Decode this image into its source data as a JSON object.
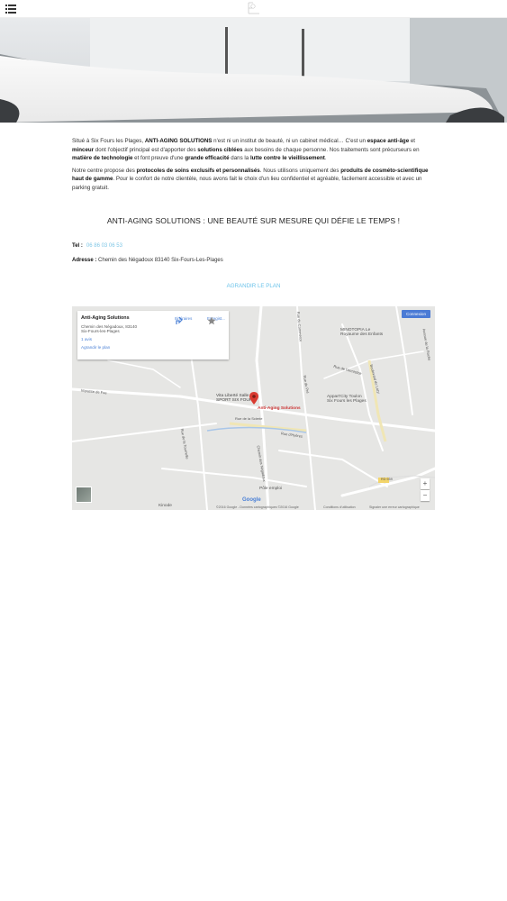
{
  "header": {
    "menu_icon": "hamburger-icon",
    "logo_icon": "brand-logo"
  },
  "intro": {
    "p1_a": "Situé à Six Fours les Plages, ",
    "p1_brand": "ANTI-AGING SOLUTIONS",
    "p1_b": " n'est ni un institut de beauté, ni un cabinet médical… C'est un ",
    "p1_c": "espace anti-âge",
    "p1_d": " et ",
    "p1_e": "minceur",
    "p1_f": " dont l'objectif principal est d'apporter des ",
    "p1_g": "solutions ciblées",
    "p1_h": " aux besoins de chaque personne. Nos traitements sont précurseurs en ",
    "p1_i": "matière de technologie",
    "p1_j": " et font preuve d'une ",
    "p1_k": "grande efficacité",
    "p1_l": " dans la ",
    "p1_m": "lutte contre le vieillissement",
    "p1_n": ".",
    "p2_a": "Notre centre propose des ",
    "p2_b": "protocoles de soins exclusifs et personnalisés",
    "p2_c": ". Nous utilisons uniquement des ",
    "p2_d": "produits de cosméto-scientifique haut de gamme",
    "p2_e": ".  Pour le confort de notre clientèle, nous avons fait le choix d'un lieu confidentiel et agréable, facilement accessible et avec un parking gratuit."
  },
  "headline": "ANTI-AGING SOLUTIONS : UNE BEAUTÉ SUR MESURE QUI DÉFIE LE TEMPS !",
  "contact": {
    "tel_label": "Tel :",
    "tel_value": "06 86 03 06 53",
    "address_label": "Adresse :",
    "address_value": "Chemin des Négadoux 83140 Six-Fours-Les-Plages"
  },
  "plan_link": "AGRANDIR LE PLAN",
  "map": {
    "card_title": "Anti-Aging Solutions",
    "card_address_1": "Chemin des Négadoux, 83140",
    "card_address_2": "Six-Fours-les-Plages",
    "card_reviews": "1 avis",
    "card_enlarge": "Agrandir le plan",
    "action_directions": "Itinéraires",
    "action_save": "Enregist...",
    "connect_label": "Connexion",
    "pin_label": "Anti-Aging Solutions",
    "labels": {
      "minotopia": "MINOTOPIA Le\nRoyaume des Enfants",
      "vita": "Vita Liberté Salle DE\nSPORT SIX FOURS",
      "appart": "Appart'City Toulon\nSix Fours les Plages",
      "pole": "Pôle emploi",
      "kinode": "Kinode",
      "route": "RD 559",
      "road1": "Rue de l'Armistice",
      "road2": "Rue de la Scierie",
      "road3": "Rue de la Tournelle",
      "road4": "Chemin des Négadoux",
      "road5": "Boulevard du Lazy",
      "road6": "Avenue de la Roche",
      "road7": "Rue du Commerce",
      "road8": "Rue d'Hyères",
      "road9": "Impasse de Foe",
      "road10": "Rue du Pré"
    },
    "zoom_in": "+",
    "zoom_out": "−",
    "google": "Google",
    "footer_1": "©2016 Google - Données cartographiques ©2016 Google",
    "footer_2": "Conditions d'utilisation",
    "footer_3": "Signaler une erreur cartographique"
  }
}
